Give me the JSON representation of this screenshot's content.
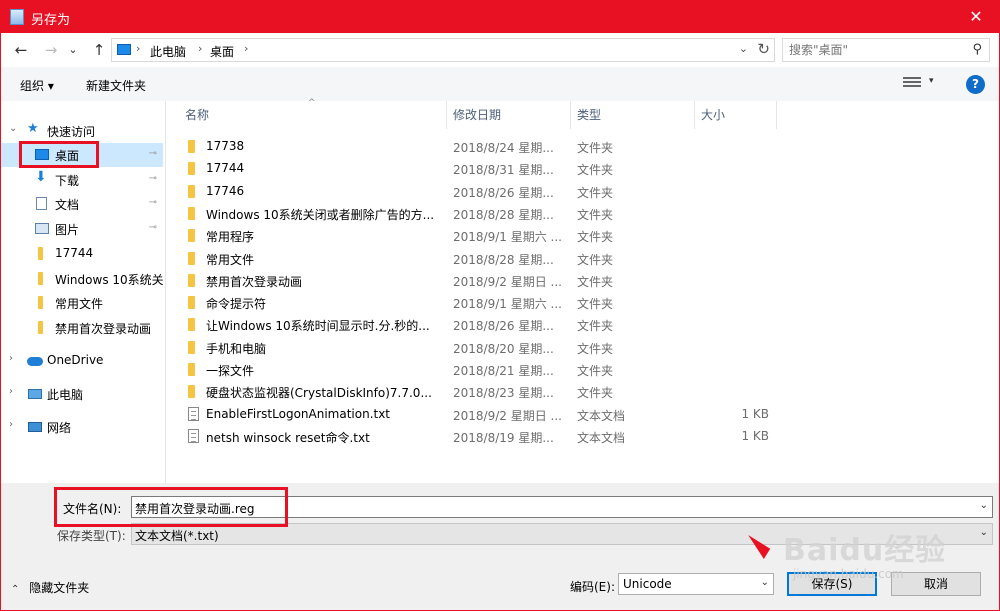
{
  "window": {
    "title": "另存为",
    "close_glyph": "✕"
  },
  "nav": {
    "back": "←",
    "forward": "→",
    "down": "⌄",
    "up": "↑",
    "breadcrumb": [
      "此电脑",
      "桌面"
    ],
    "chevron": "›",
    "refresh": "↻",
    "dropdown": "⌄",
    "search_placeholder": "搜索\"桌面\"",
    "search_glyph": "⚲"
  },
  "toolbar": {
    "organize": "组织 ▾",
    "new_folder": "新建文件夹",
    "view_dd": "▾",
    "help": "?"
  },
  "sidebar": {
    "items": [
      {
        "label": "快速访问",
        "icon": "star-icon",
        "expander": "⌄"
      },
      {
        "label": "桌面",
        "icon": "desktop-icon",
        "pinned": true,
        "selected": true
      },
      {
        "label": "下载",
        "icon": "download-icon",
        "pinned": true
      },
      {
        "label": "文档",
        "icon": "document-icon",
        "pinned": true
      },
      {
        "label": "图片",
        "icon": "picture-icon",
        "pinned": true
      },
      {
        "label": "17744",
        "icon": "folder-icon"
      },
      {
        "label": "Windows 10系统关",
        "icon": "folder-icon"
      },
      {
        "label": "常用文件",
        "icon": "folder-icon"
      },
      {
        "label": "禁用首次登录动画",
        "icon": "folder-icon"
      },
      {
        "label": "OneDrive",
        "icon": "cloud-icon",
        "expander": "›"
      },
      {
        "label": "此电脑",
        "icon": "computer-icon",
        "expander": "›"
      },
      {
        "label": "网络",
        "icon": "network-icon",
        "expander": "›"
      }
    ],
    "pin_glyph": "⊸"
  },
  "columns": {
    "name": "名称",
    "date": "修改日期",
    "type": "类型",
    "size": "大小",
    "sort_caret": "^"
  },
  "files": [
    {
      "name": "17738",
      "date": "2018/8/24 星期...",
      "type": "文件夹",
      "size": "",
      "kind": "folder"
    },
    {
      "name": "17744",
      "date": "2018/8/31 星期...",
      "type": "文件夹",
      "size": "",
      "kind": "folder"
    },
    {
      "name": "17746",
      "date": "2018/8/26 星期...",
      "type": "文件夹",
      "size": "",
      "kind": "folder"
    },
    {
      "name": "Windows 10系统关闭或者删除广告的方...",
      "date": "2018/8/28 星期...",
      "type": "文件夹",
      "size": "",
      "kind": "folder"
    },
    {
      "name": "常用程序",
      "date": "2018/9/1 星期六 ...",
      "type": "文件夹",
      "size": "",
      "kind": "folder"
    },
    {
      "name": "常用文件",
      "date": "2018/8/28 星期...",
      "type": "文件夹",
      "size": "",
      "kind": "folder"
    },
    {
      "name": "禁用首次登录动画",
      "date": "2018/9/2 星期日 ...",
      "type": "文件夹",
      "size": "",
      "kind": "folder"
    },
    {
      "name": "命令提示符",
      "date": "2018/9/1 星期六 ...",
      "type": "文件夹",
      "size": "",
      "kind": "folder"
    },
    {
      "name": "让Windows 10系统时间显示时.分.秒的...",
      "date": "2018/8/26 星期...",
      "type": "文件夹",
      "size": "",
      "kind": "folder"
    },
    {
      "name": "手机和电脑",
      "date": "2018/8/20 星期...",
      "type": "文件夹",
      "size": "",
      "kind": "folder"
    },
    {
      "name": "一探文件",
      "date": "2018/8/21 星期...",
      "type": "文件夹",
      "size": "",
      "kind": "folder"
    },
    {
      "name": "硬盘状态监视器(CrystalDiskInfo)7.7.0...",
      "date": "2018/8/23 星期...",
      "type": "文件夹",
      "size": "",
      "kind": "folder"
    },
    {
      "name": "EnableFirstLogonAnimation.txt",
      "date": "2018/9/2 星期日 ...",
      "type": "文本文档",
      "size": "1 KB",
      "kind": "text"
    },
    {
      "name": "netsh winsock reset命令.txt",
      "date": "2018/8/19 星期...",
      "type": "文本文档",
      "size": "1 KB",
      "kind": "text"
    }
  ],
  "bottom": {
    "filename_label": "文件名(N):",
    "filename_value": "禁用首次登录动画.reg",
    "filetype_label": "保存类型(T):",
    "filetype_value": "文本文档(*.txt)",
    "dropdown": "⌄",
    "hide_folders": "隐藏文件夹",
    "hide_glyph": "⌃",
    "encoding_label": "编码(E):",
    "encoding_value": "Unicode",
    "save": "保存(S)",
    "cancel": "取消"
  },
  "watermark": {
    "brand": "Baidu经验",
    "url": "jingyan.baidu.com"
  },
  "colors": {
    "title_bar": "#e81123",
    "selection": "#cce8ff",
    "folder": "#f4c542",
    "highlight_box": "#e81123"
  }
}
